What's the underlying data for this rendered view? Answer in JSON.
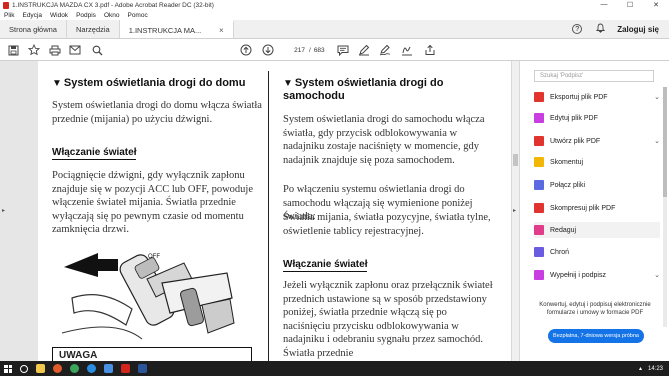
{
  "window": {
    "title": "1.INSTRUKCJA MAZDA CX 3.pdf - Adobe Acrobat Reader DC (32-bit)",
    "minimize": "—",
    "maximize": "☐",
    "close": "✕"
  },
  "menu": [
    "Plik",
    "Edycja",
    "Widok",
    "Podpis",
    "Okno",
    "Pomoc"
  ],
  "tabs": {
    "home": "Strona główna",
    "tools": "Narzędzia",
    "doc": "1.INSTRUKCJA MA...",
    "close": "×"
  },
  "header_right": {
    "help": "?",
    "login": "Zaloguj się"
  },
  "toolbar": {
    "page_current": "217",
    "page_sep": "/",
    "page_total": "683"
  },
  "document": {
    "col1": {
      "heading": "System oświetlania drogi do domu",
      "para1": "System oświetlania drogi do domu włącza światła przednie (mijania) po użyciu dźwigni.",
      "subheading": "Włączanie świateł",
      "para2": "Pociągnięcie dźwigni, gdy wyłącznik zapłonu znajduje się w pozycji ACC lub OFF, powoduje włączenie świateł mijania. Światła przednie wyłączają się po pewnym czasie od momentu zamknięcia drzwi.",
      "illus_label": "OFF",
      "warning": "UWAGA"
    },
    "col2": {
      "heading": "System oświetlania drogi do samochodu",
      "para1": "System oświetlania drogi do samochodu włącza światła, gdy przycisk odblokowywania w nadajniku zostaje naciśnięty w momencie, gdy nadajnik znajduje się poza samochodem.",
      "para2": "Po włączeniu systemu oświetlania drogi do samochodu włączają się wymienione poniżej światła:",
      "para3": "Światła mijania, światła pozycyjne, światła tylne, oświetlenie tablicy rejestracyjnej.",
      "subheading": "Włączanie świateł",
      "para4": "Jeżeli wyłącznik zapłonu oraz przełącznik świateł przednich ustawione są w sposób przedstawiony poniżej, światła przednie włączą się po naciśnięciu przycisku odblokowywania w nadajniku i odebraniu sygnału przez samochód. Światła przednie"
    }
  },
  "side_panel": {
    "search_placeholder": "Szukaj 'Podpisz'",
    "tools": [
      {
        "label": "Eksportuj plik PDF",
        "color": "#e2342f"
      },
      {
        "label": "Edytuj plik PDF",
        "color": "#c93ee0"
      },
      {
        "label": "Utwórz plik PDF",
        "color": "#e2342f"
      },
      {
        "label": "Skomentuj",
        "color": "#f2b705"
      },
      {
        "label": "Połącz pliki",
        "color": "#5b6ae0"
      },
      {
        "label": "Skompresuj plik PDF",
        "color": "#e2342f"
      },
      {
        "label": "Redaguj",
        "color": "#e03c8a"
      },
      {
        "label": "Chroń",
        "color": "#6b5be0"
      },
      {
        "label": "Wypełnij i podpisz",
        "color": "#c93ee0"
      }
    ],
    "promo_text": "Konwertuj, edytuj i podpisuj elektronicznie formularze i umowy w formacie PDF",
    "promo_button": "Bezpłatna, 7-dniowa wersja próbna"
  },
  "taskbar": {
    "clock": "14:23"
  }
}
